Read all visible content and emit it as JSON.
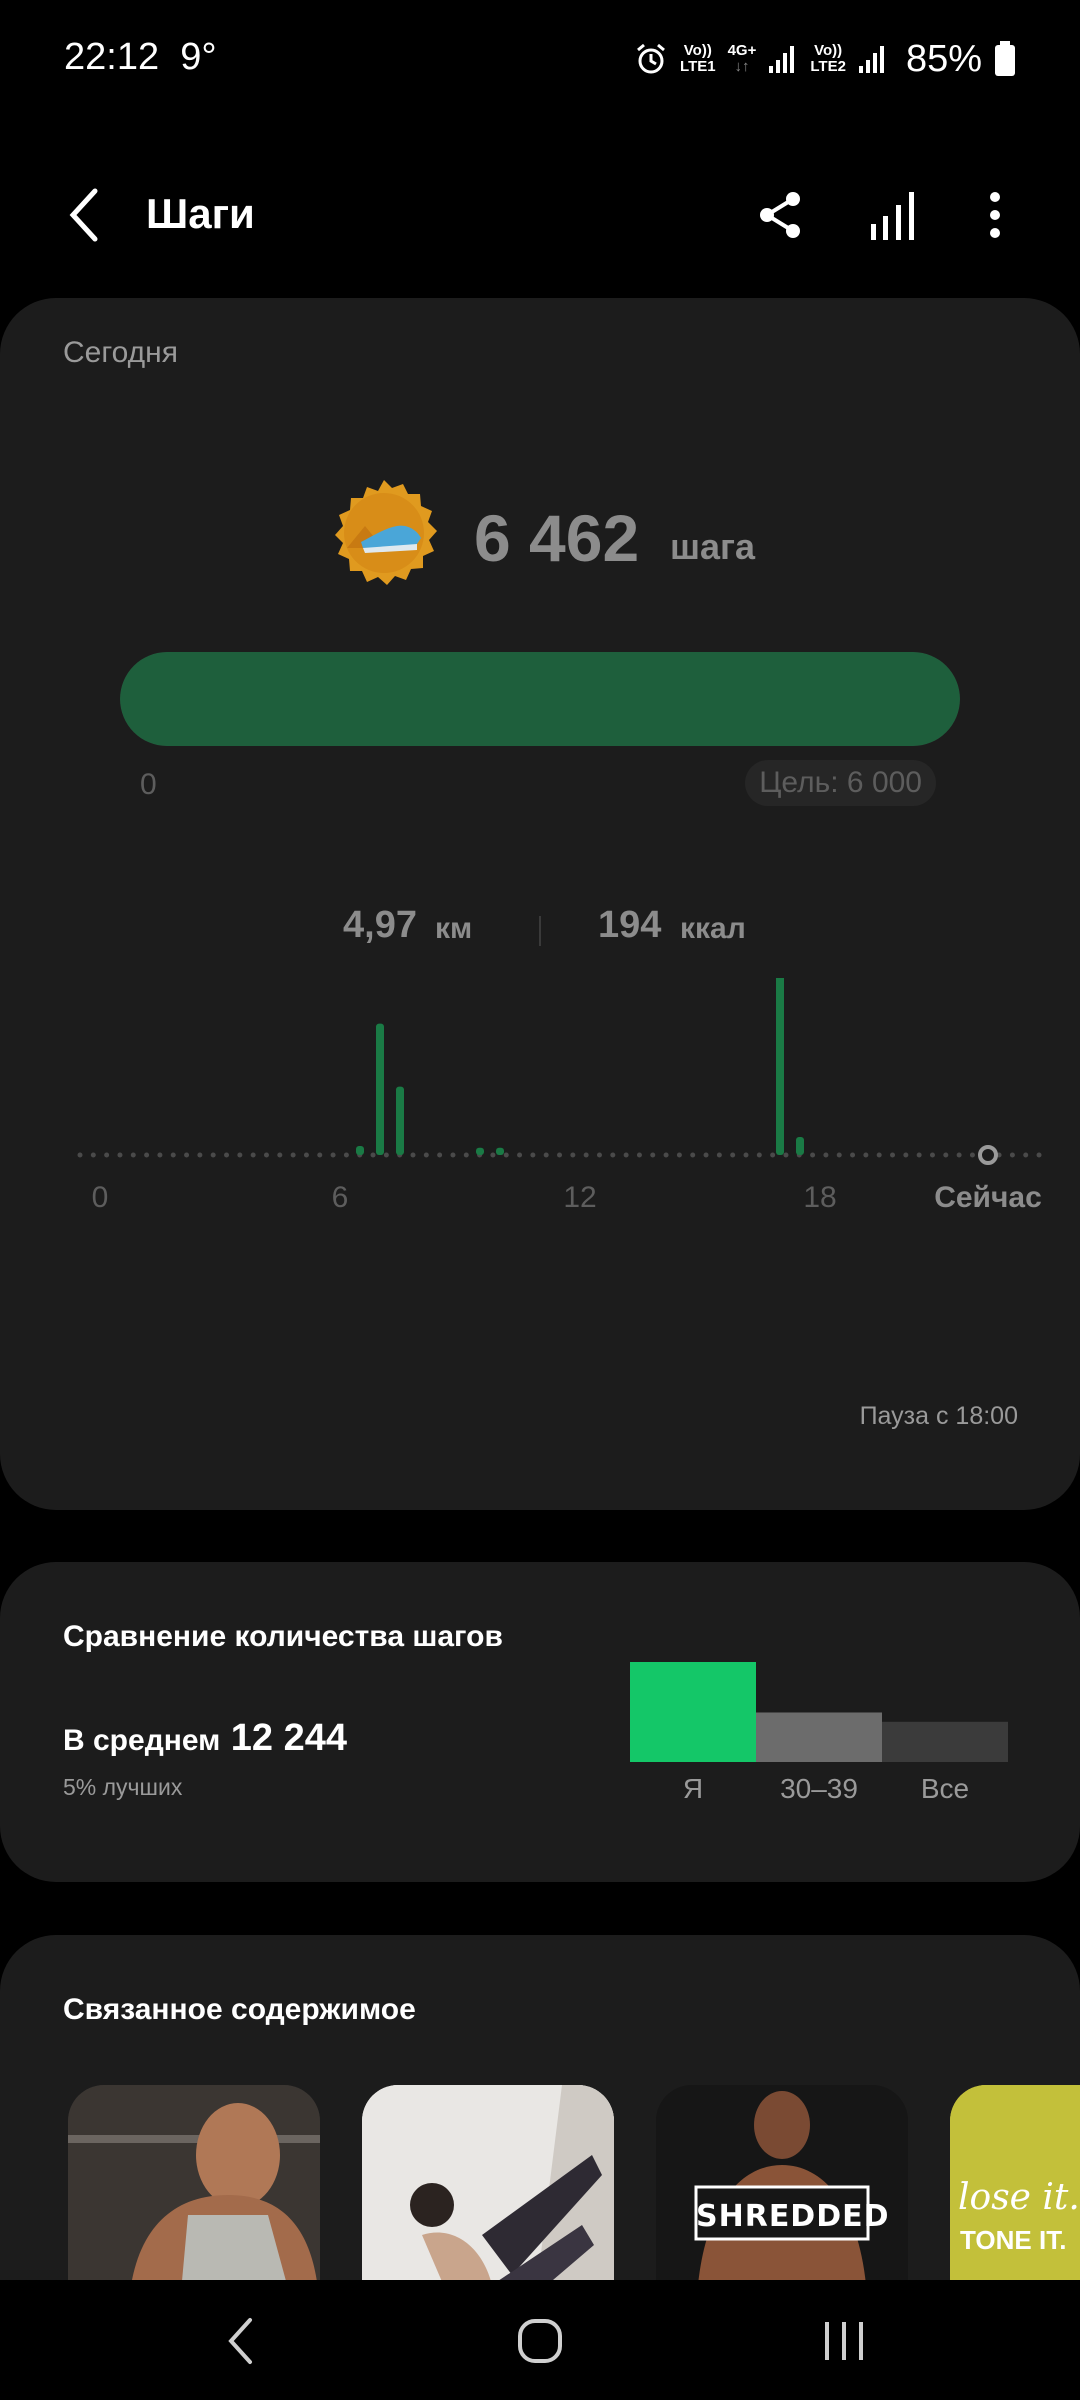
{
  "status_bar": {
    "time": "22:12",
    "temperature": "9°",
    "sim1": {
      "top": "Vo))",
      "bottom": "LTE1"
    },
    "network_type": "4G+",
    "sim2": {
      "top": "Vo))",
      "bottom": "LTE2"
    },
    "battery": "85%",
    "icons": [
      "alarm-icon",
      "signal-icon",
      "battery-icon"
    ]
  },
  "app_bar": {
    "title": "Шаги",
    "icons": [
      "back-arrow-icon",
      "share-icon",
      "bar-chart-icon",
      "more-vertical-icon"
    ]
  },
  "today": {
    "label": "Сегодня",
    "steps": "6 462",
    "steps_unit": "шага",
    "progress_fraction": 1.0,
    "progress_min": "0",
    "goal": "Цель: 6 000",
    "distance_value": "4,97",
    "distance_unit": "км",
    "calories_value": "194",
    "calories_unit": "ккал",
    "pause_note": "Пауза с 18:00",
    "colors": {
      "accent": "#1e5f3c",
      "bar": "#1a7a45",
      "muted": "#8c8c8c"
    }
  },
  "chart_data": [
    {
      "type": "bar",
      "title": "",
      "x_ticks": [
        "0",
        "6",
        "12",
        "18",
        "Сейчас"
      ],
      "x_range": [
        0,
        23
      ],
      "bars": [
        {
          "hour": 6.5,
          "value": 0.05
        },
        {
          "hour": 7.0,
          "value": 0.73
        },
        {
          "hour": 7.5,
          "value": 0.38
        },
        {
          "hour": 9.5,
          "value": 0.04
        },
        {
          "hour": 10.0,
          "value": 0.04
        },
        {
          "hour": 17.0,
          "value": 1.0
        },
        {
          "hour": 17.5,
          "value": 0.1
        }
      ],
      "now_hour": 22.2
    },
    {
      "type": "bar",
      "title": "Сравнение количества шагов",
      "categories": [
        "Я",
        "30–39",
        "Все"
      ],
      "values": [
        6462,
        3200,
        2600
      ],
      "colors": [
        "#14c768",
        "#6c6c6c",
        "#3b3b3b"
      ]
    }
  ],
  "compare": {
    "title": "Сравнение количества шагов",
    "avg_label": "В среднем",
    "avg_value": "12 244",
    "percentile": "5% лучших",
    "categories": [
      "Я",
      "30–39",
      "Все"
    ]
  },
  "related": {
    "title": "Связанное содержимое",
    "items": [
      {
        "name": "athlete-tank-top-thumbnail",
        "caption": ""
      },
      {
        "name": "yoga-stretch-thumbnail",
        "caption": ""
      },
      {
        "name": "shredded-thumbnail",
        "caption": "SHREDDED"
      },
      {
        "name": "lose-it-tone-it-thumbnail",
        "caption": "lose it.",
        "caption2": "TONE IT."
      }
    ]
  },
  "nav_bar": {
    "icons": [
      "nav-back-icon",
      "nav-home-icon",
      "nav-recents-icon"
    ]
  }
}
